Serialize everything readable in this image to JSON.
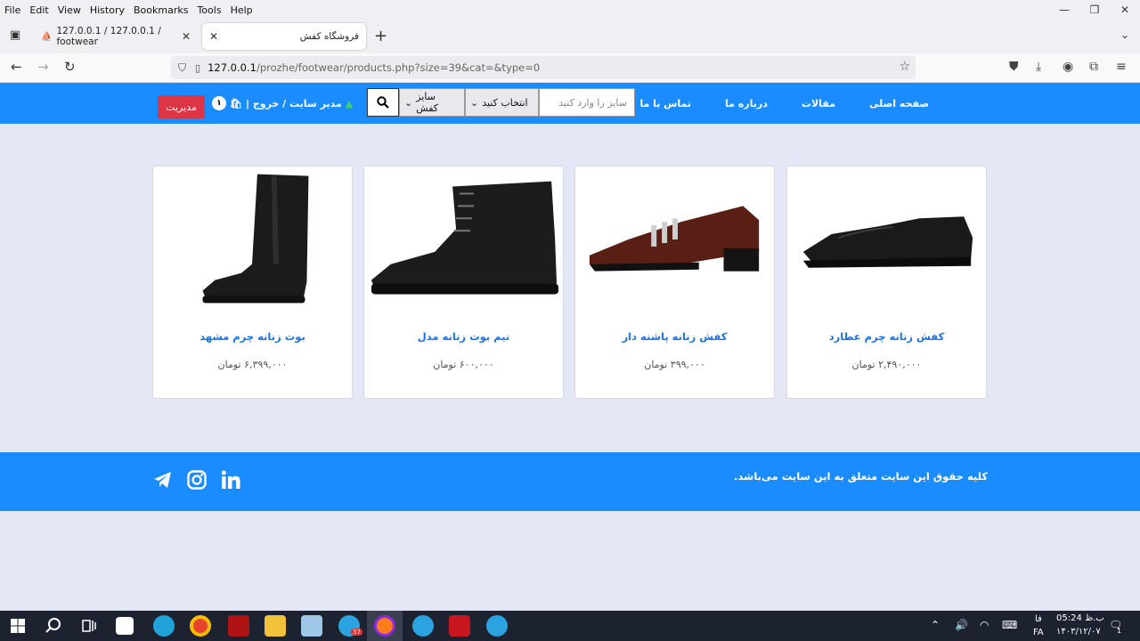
{
  "menu": [
    "File",
    "Edit",
    "View",
    "History",
    "Bookmarks",
    "Tools",
    "Help"
  ],
  "window_controls": {
    "minimize": "—",
    "restore": "❐",
    "close": "✕"
  },
  "tabs": [
    {
      "label": "127.0.0.1 / 127.0.0.1 / footwear",
      "close": "✕"
    },
    {
      "label": "فروشگاه کفش",
      "close": "✕"
    }
  ],
  "new_tab": "+",
  "url": {
    "host": "127.0.0.1",
    "path": "/prozhe/footwear/products.php?size=39&cat=&type=0"
  },
  "site": {
    "nav": [
      "صفحه اصلی",
      "مقالات",
      "درباره ما",
      "تماس با ما"
    ],
    "search": {
      "placeholder": "سایز را وارد کنید",
      "category_select": "انتخاب کنید",
      "size_select": "سایز کفش"
    },
    "user": {
      "label": "مدیر سایت / خروج |",
      "cart_count": "۱"
    },
    "admin_button": "مدیریت"
  },
  "products": [
    {
      "name": "کفش زنانه چرم عطارد",
      "price": "۲,۴۹۰,۰۰۰ تومان",
      "kind": "loafer"
    },
    {
      "name": "کفش زنانه پاشنه دار",
      "price": "۳۹۹,۰۰۰ تومان",
      "kind": "heel"
    },
    {
      "name": "نیم بوت زنانه مدل",
      "price": "۶۰۰,۰۰۰ تومان",
      "kind": "ankle-boot"
    },
    {
      "name": "بوت زنانه چرم مشهد",
      "price": "۶,۳۹۹,۰۰۰ تومان",
      "kind": "tall-boot"
    }
  ],
  "footer": {
    "copyright": "کلیه حقوق این سایت متعلق به این سایت می‌باشد."
  },
  "taskbar": {
    "badge_telegram": "37",
    "clock_time": "05:24 ب.ظ",
    "clock_date": "۱۴۰۳/۱۲/۰۷",
    "lang": "FA",
    "lang_top": "فا",
    "notif_count": "1"
  },
  "colors": {
    "brand_blue": "#1a8cff",
    "admin_red": "#dc3545",
    "link_blue": "#1a73e8"
  }
}
